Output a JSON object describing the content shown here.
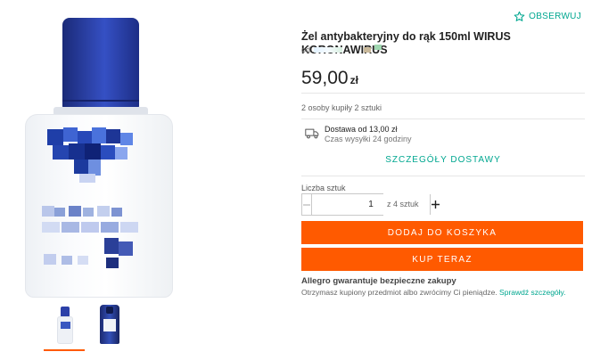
{
  "follow": {
    "label": "OBSERWUJ",
    "icon": "star-outline-icon"
  },
  "product": {
    "title": "Żel antybakteryjny do rąk 150ml WIRUS KORONAWIRUS",
    "seller_prefix": "od",
    "price_main": "59,00",
    "price_currency": "zł",
    "bought_info": "2 osoby kupiły 2 sztuki"
  },
  "delivery": {
    "icon": "truck-icon",
    "cost": "Dostawa od 13,00 zł",
    "time": "Czas wysyłki 24 godziny",
    "details_link": "SZCZEGÓŁY DOSTAWY"
  },
  "quantity": {
    "label": "Liczba sztuk",
    "value": "1",
    "of_total": "z 4 sztuk"
  },
  "actions": {
    "add_to_cart": "DODAJ DO KOSZYKA",
    "buy_now": "KUP TERAZ"
  },
  "guarantee": {
    "title": "Allegro gwarantuje bezpieczne zakupy",
    "text": "Otrzymasz kupiony przedmiot albo zwrócimy Ci pieniądze.",
    "link": "Sprawdź szczegóły."
  },
  "colors": {
    "accent": "#ff5a00",
    "link": "#00a790"
  }
}
